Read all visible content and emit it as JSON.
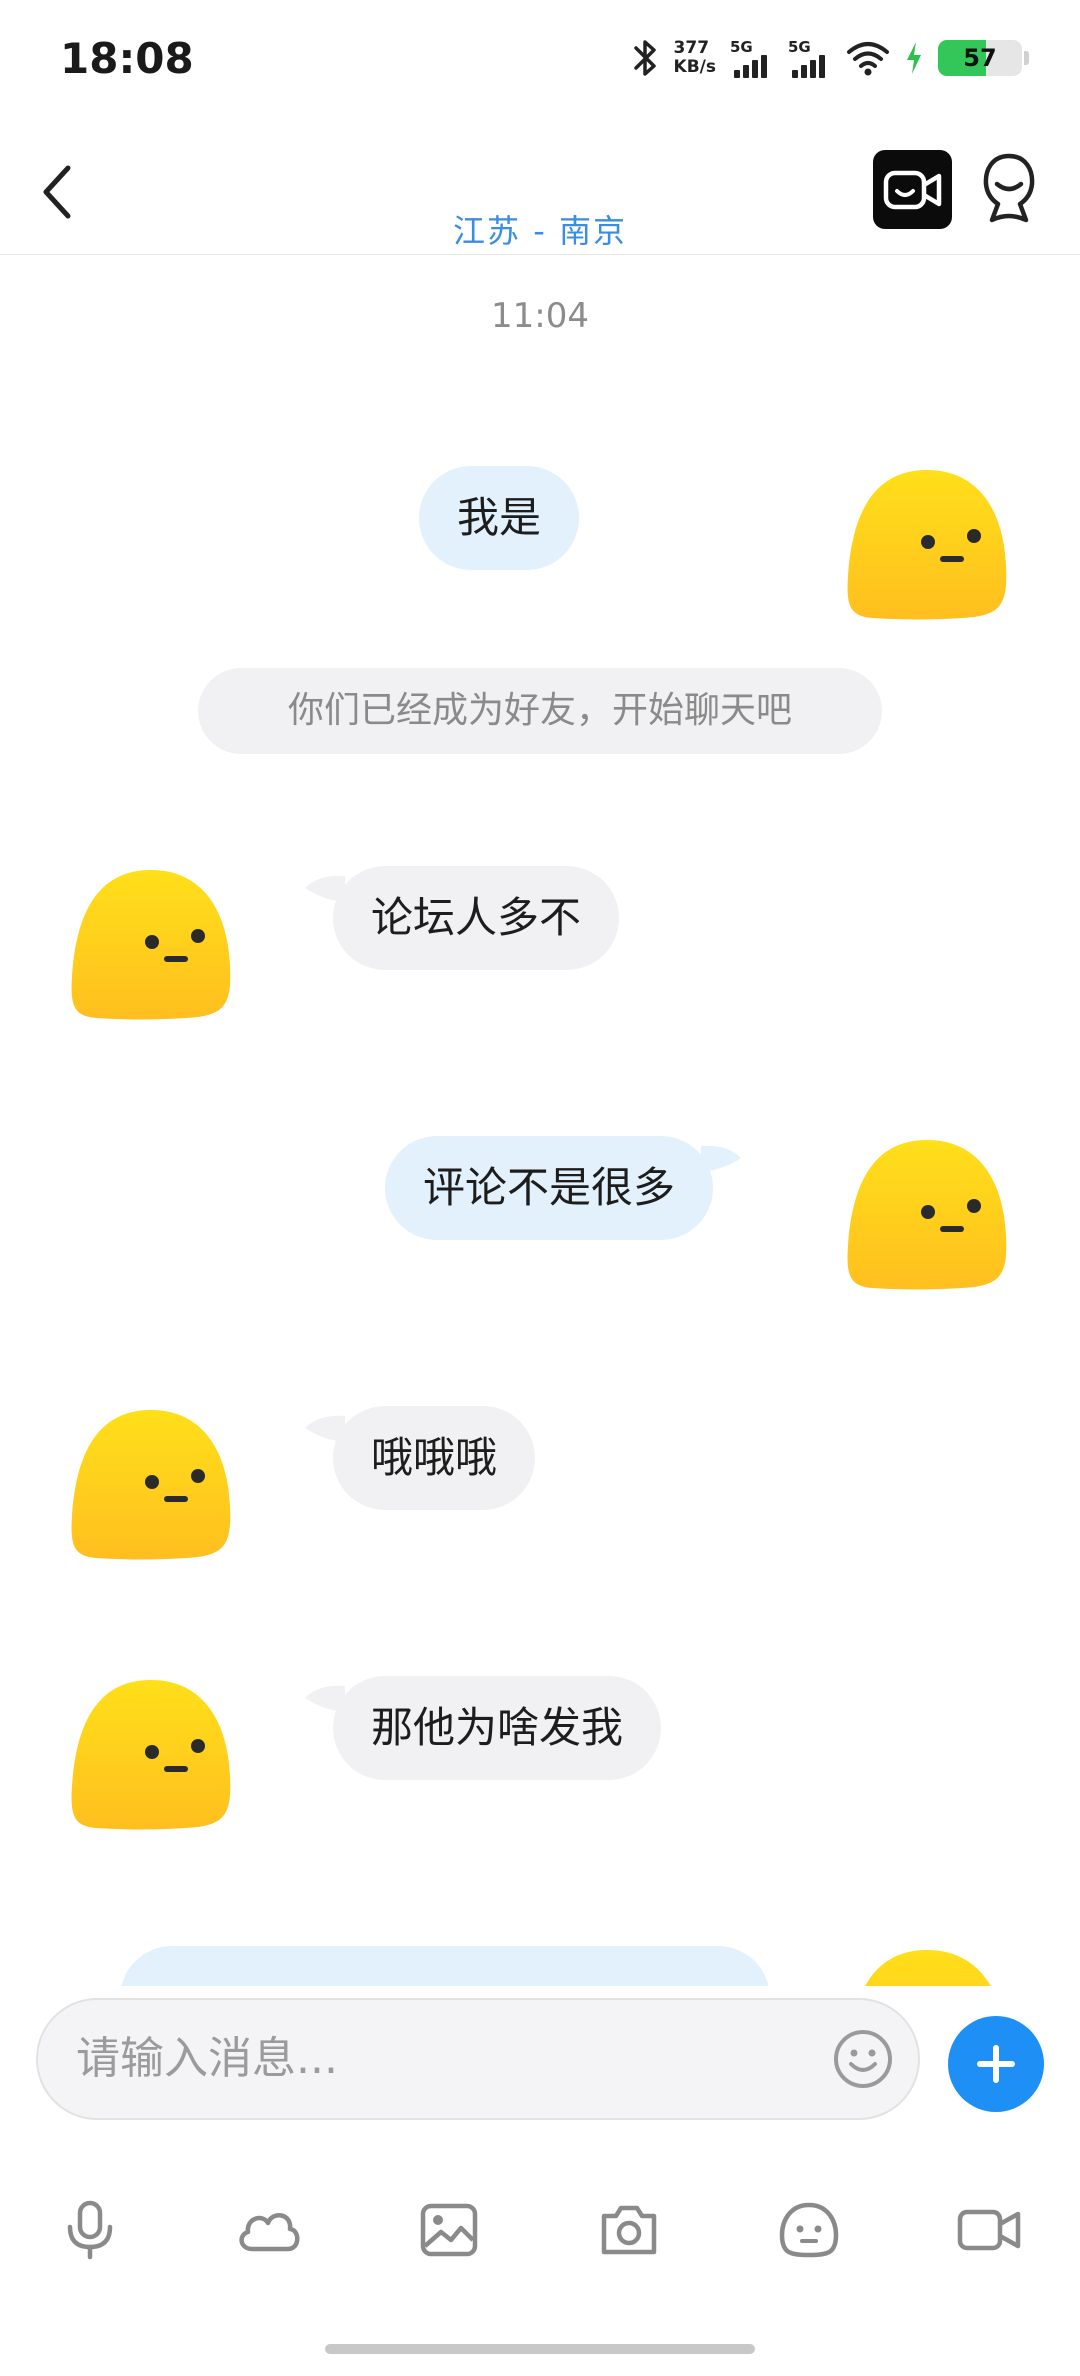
{
  "status_bar": {
    "time": "18:08",
    "net_speed_value": "377",
    "net_speed_unit": "KB/s",
    "signal_1": "5G",
    "signal_2": "5G",
    "battery": "57",
    "battery_level": 0.57,
    "battery_color": "#33c759"
  },
  "header": {
    "location": "江苏 - 南京"
  },
  "chat": {
    "timestamp": "11:04",
    "system_message": "你们已经成为好友，开始聊天吧",
    "messages": [
      {
        "side": "out",
        "text": "我是"
      },
      {
        "side": "in",
        "text": "论坛人多不"
      },
      {
        "side": "out",
        "text": "评论不是很多"
      },
      {
        "side": "in",
        "text": "哦哦哦"
      },
      {
        "side": "in",
        "text": "那他为啥发我"
      }
    ]
  },
  "input": {
    "placeholder": "请输入消息..."
  },
  "colors": {
    "accent": "#1e90f5",
    "outgoing_bubble": "#e3f1fd",
    "incoming_bubble": "#f1f1f3",
    "avatar_yellow": "#ffd21f"
  }
}
